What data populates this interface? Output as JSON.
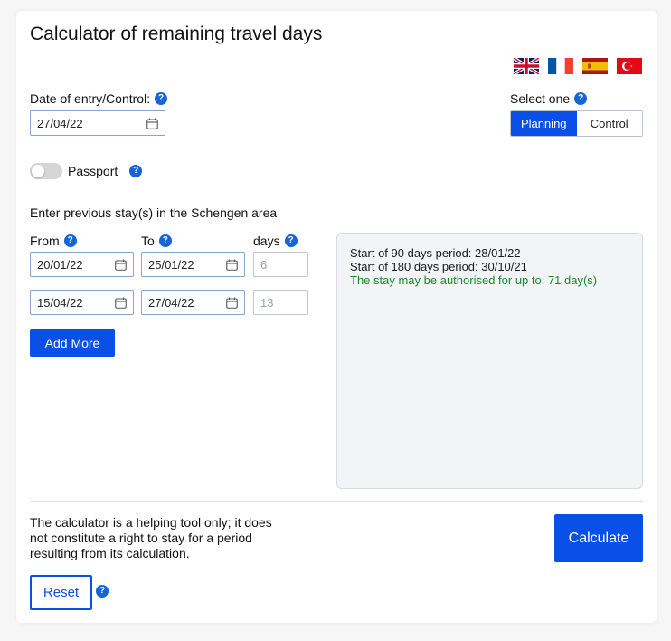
{
  "title": "Calculator of remaining travel days",
  "languages": [
    {
      "name": "uk-flag-icon",
      "lang": "English"
    },
    {
      "name": "fr-flag-icon",
      "lang": "French"
    },
    {
      "name": "es-flag-icon",
      "lang": "Spanish"
    },
    {
      "name": "tr-flag-icon",
      "lang": "Turkish"
    }
  ],
  "entry": {
    "label": "Date of entry/Control:",
    "value": "27/04/22"
  },
  "mode": {
    "label": "Select one",
    "options": [
      "Planning",
      "Control"
    ],
    "selected": "Planning"
  },
  "passport": {
    "label": "Passport",
    "on": false
  },
  "stays": {
    "section_label": "Enter previous stay(s) in the Schengen area",
    "from_label": "From",
    "to_label": "To",
    "days_label": "days",
    "rows": [
      {
        "from": "20/01/22",
        "to": "25/01/22",
        "days": "6"
      },
      {
        "from": "15/04/22",
        "to": "27/04/22",
        "days": "13"
      }
    ],
    "add_more_label": "Add More"
  },
  "results": {
    "line1": "Start of 90 days period: 28/01/22",
    "line2": "Start of 180 days period: 30/10/21",
    "line3": "The stay may be authorised for up to: 71 day(s)"
  },
  "disclaimer": "The calculator is a helping tool only; it does not constitute a right to stay for a period resulting from its calculation.",
  "calculate_label": "Calculate",
  "reset_label": "Reset",
  "help_glyph": "?",
  "colors": {
    "primary": "#0a50e8",
    "help": "#1565d8",
    "success": "#1c8a2b"
  }
}
